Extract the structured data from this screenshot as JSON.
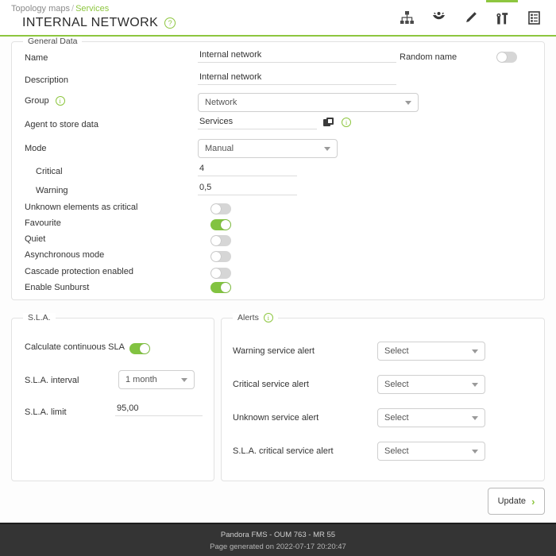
{
  "header": {
    "breadcrumb_root": "Topology maps",
    "breadcrumb_sep": "/",
    "breadcrumb_current": "Services",
    "title": "INTERNAL NETWORK",
    "help_glyph": "?",
    "tabs": [
      {
        "name": "topology-tree-tab",
        "icon": "network-tree-icon",
        "active": false
      },
      {
        "name": "sunburst-tab",
        "icon": "sunburst-icon",
        "active": false
      },
      {
        "name": "edit-tab",
        "icon": "pencil-icon",
        "active": false
      },
      {
        "name": "tools-tab",
        "icon": "tools-icon",
        "active": true
      },
      {
        "name": "list-tab",
        "icon": "list-icon",
        "active": false
      }
    ]
  },
  "general": {
    "legend": "General Data",
    "name_label": "Name",
    "name_value": "Internal network",
    "random_name_label": "Random name",
    "random_name_on": false,
    "description_label": "Description",
    "description_value": "Internal network",
    "group_label": "Group",
    "group_value": "Network",
    "agent_label": "Agent to store data",
    "agent_value": "Services",
    "mode_label": "Mode",
    "mode_value": "Manual",
    "critical_label": "Critical",
    "critical_value": "4",
    "warning_label": "Warning",
    "warning_value": "0,5",
    "toggles": [
      {
        "label": "Unknown elements as critical",
        "on": false
      },
      {
        "label": "Favourite",
        "on": true
      },
      {
        "label": "Quiet",
        "on": false
      },
      {
        "label": "Asynchronous mode",
        "on": false
      },
      {
        "label": "Cascade protection enabled",
        "on": false
      },
      {
        "label": "Enable Sunburst",
        "on": true
      }
    ]
  },
  "sla": {
    "legend": "S.L.A.",
    "continuous_label": "Calculate continuous SLA",
    "continuous_on": true,
    "interval_label": "S.L.A. interval",
    "interval_value": "1 month",
    "limit_label": "S.L.A. limit",
    "limit_value": "95,00"
  },
  "alerts": {
    "legend": "Alerts",
    "rows": [
      {
        "label": "Warning service alert",
        "value": "Select"
      },
      {
        "label": "Critical service alert",
        "value": "Select"
      },
      {
        "label": "Unknown service alert",
        "value": "Select"
      },
      {
        "label": "S.L.A. critical service alert",
        "value": "Select"
      }
    ]
  },
  "actions": {
    "update_label": "Update",
    "update_chevron": "›"
  },
  "footer": {
    "line1": "Pandora FMS - OUM 763 - MR 55",
    "line2": "Page generated on 2022-07-17 20:20:47"
  },
  "colors": {
    "accent_green": "#8dc63f",
    "toggle_on": "#82c341",
    "footer_bg": "#343434"
  }
}
